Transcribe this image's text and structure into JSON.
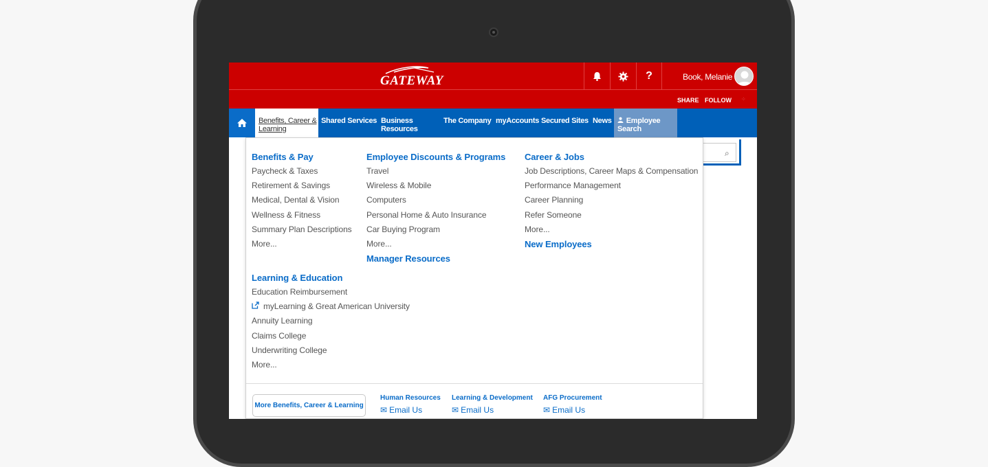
{
  "header": {
    "logo_text": "Gateway",
    "user_name": "Book, Melanie",
    "icons": [
      "bell-icon",
      "gear-icon",
      "help-icon"
    ],
    "help_glyph": "?"
  },
  "subbar": {
    "share_label": "SHARE",
    "follow_label": "FOLLOW"
  },
  "nav": {
    "items": [
      {
        "label": "Benefits, Career & Learning",
        "active": true
      },
      {
        "label": "Shared Services"
      },
      {
        "label": "Business Resources"
      },
      {
        "label": "The Company"
      },
      {
        "label": "myAccounts"
      },
      {
        "label": "Secured Sites"
      },
      {
        "label": "News"
      },
      {
        "label": "Employee Search"
      }
    ]
  },
  "menu": {
    "benefits": {
      "heading": "Benefits & Pay",
      "links": [
        "Paycheck & Taxes",
        "Retirement & Savings",
        "Medical, Dental & Vision",
        "Wellness & Fitness",
        "Summary Plan Descriptions",
        "More..."
      ]
    },
    "discounts": {
      "heading": "Employee Discounts & Programs",
      "links": [
        "Travel",
        "Wireless & Mobile",
        "Computers",
        "Personal Home & Auto Insurance",
        "Car Buying Program",
        "More..."
      ]
    },
    "manager": {
      "heading": "Manager Resources"
    },
    "career": {
      "heading": "Career & Jobs",
      "links": [
        "Job Descriptions, Career Maps & Compensation",
        "Performance Management",
        "Career Planning",
        "Refer Someone",
        "More..."
      ]
    },
    "new_employees": {
      "heading": "New Employees"
    },
    "learning": {
      "heading": "Learning & Education",
      "links": [
        "Education Reimbursement",
        "myLearning & Great American University",
        "Annuity Learning",
        "Claims College",
        "Underwriting College",
        "More..."
      ]
    }
  },
  "footer": {
    "more_button": "More Benefits, Career & Learning",
    "contacts": [
      {
        "title": "Human Resources",
        "email": "Email Us"
      },
      {
        "title": "Learning & Development",
        "email": "Email Us"
      },
      {
        "title": "AFG Procurement",
        "email": "Email Us"
      }
    ]
  },
  "colors": {
    "brand_red": "#cc0000",
    "nav_blue": "#0060b8",
    "link_blue": "#0a6cc8"
  }
}
